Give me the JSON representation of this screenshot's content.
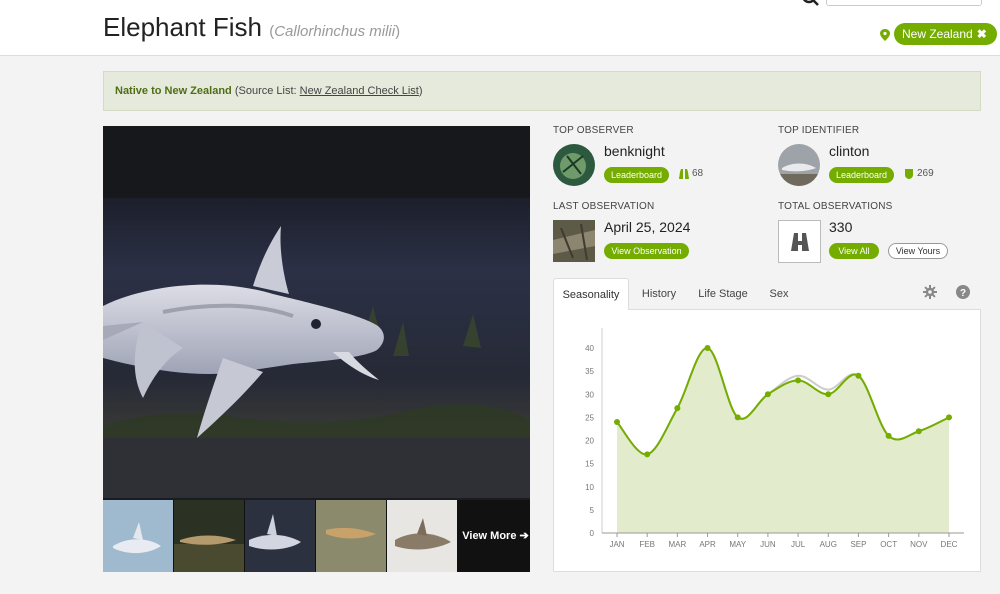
{
  "taxon": {
    "common_name": "Elephant Fish",
    "scientific_name": "Callorhinchus milii"
  },
  "place_filter": {
    "label": "New Zealand",
    "remove_icon": "close-icon"
  },
  "establishment": {
    "status": "Native to New Zealand",
    "source_prefix": "(Source List: ",
    "source_link": "New Zealand Check List",
    "source_suffix": ")"
  },
  "photos": {
    "view_more": "View More"
  },
  "top_observer": {
    "label": "TOP OBSERVER",
    "name": "benknight",
    "button": "Leaderboard",
    "count": "68",
    "count_icon": "binoculars-icon"
  },
  "top_identifier": {
    "label": "TOP IDENTIFIER",
    "name": "clinton",
    "button": "Leaderboard",
    "count": "269",
    "count_icon": "badge-icon"
  },
  "last_observation": {
    "label": "LAST OBSERVATION",
    "date": "April 25, 2024",
    "button": "View Observation"
  },
  "total_observations": {
    "label": "TOTAL OBSERVATIONS",
    "count": "330",
    "view_all": "View All",
    "view_yours": "View Yours"
  },
  "tabs": [
    {
      "label": "Seasonality",
      "active": true
    },
    {
      "label": "History",
      "active": false
    },
    {
      "label": "Life Stage",
      "active": false
    },
    {
      "label": "Sex",
      "active": false
    }
  ],
  "colors": {
    "brand_green": "#74ac00",
    "series_line": "#74ac00",
    "series_fill": "#e2eccc",
    "secondary_line": "#cccccc"
  },
  "chart_data": {
    "type": "area",
    "categories": [
      "JAN",
      "FEB",
      "MAR",
      "APR",
      "MAY",
      "JUN",
      "JUL",
      "AUG",
      "SEP",
      "OCT",
      "NOV",
      "DEC"
    ],
    "series": [
      {
        "values": [
          24,
          17,
          27,
          40,
          25,
          30,
          33,
          30,
          34,
          21,
          22,
          25
        ]
      },
      {
        "values": [
          24,
          17,
          27,
          40,
          25,
          30,
          34,
          31,
          34,
          21,
          22,
          25
        ]
      }
    ],
    "yticks": [
      0,
      5,
      10,
      15,
      20,
      25,
      30,
      35,
      40
    ],
    "ylim": [
      0,
      40
    ],
    "smooth": true,
    "grid": false
  }
}
